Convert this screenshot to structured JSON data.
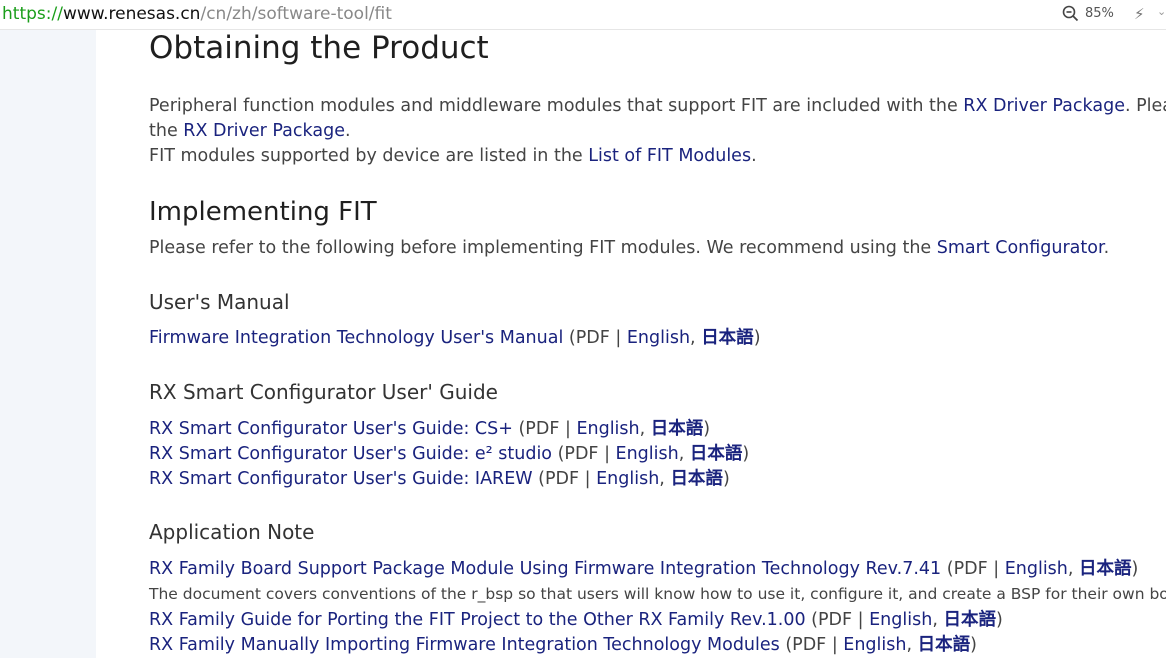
{
  "browser": {
    "url_scheme": "https://",
    "url_host": "www.renesas.cn",
    "url_path": "/cn/zh/software-tool/fit",
    "zoom_level": "85%"
  },
  "page": {
    "obtaining_title": "Obtaining the Product",
    "obtain_p1_a": "Peripheral function modules and middleware modules that support FIT are included with the ",
    "obtain_p1_link": "RX Driver Package",
    "obtain_p1_b": ". Please do",
    "obtain_p2_a": "the ",
    "obtain_p2_link": "RX Driver Package",
    "obtain_p2_b": ".",
    "obtain_p3_a": "FIT modules supported by device are listed in the ",
    "obtain_p3_link": "List of FIT Modules",
    "obtain_p3_b": ".",
    "impl_title": "Implementing FIT",
    "impl_text_a": "Please refer to the following before implementing FIT modules. We recommend using the ",
    "impl_text_link": "Smart Configurator",
    "impl_text_b": ".",
    "um_title": "User's Manual",
    "um_link": "Firmware Integration Technology User's Manual",
    "sc_title": "RX Smart Configurator User' Guide",
    "sc_links": [
      "RX Smart Configurator User's Guide: CS+",
      "RX Smart Configurator User's Guide: e² studio",
      "RX Smart Configurator User's Guide: IAREW"
    ],
    "an_title": "Application Note",
    "an_link1": "RX Family Board Support Package Module Using Firmware Integration Technology Rev.7.41",
    "an_desc1": "The document covers conventions of the r_bsp so that users will know how to use it, configure it, and create a BSP for their own board.",
    "an_link2": "RX Family Guide for Porting the FIT Project to the Other RX Family Rev.1.00",
    "an_link3": "RX Family Manually Importing Firmware Integration Technology Modules"
  },
  "doc": {
    "pdf_open": " (PDF | ",
    "english": "English",
    "comma": ", ",
    "japanese": "日本語",
    "close": ")"
  }
}
